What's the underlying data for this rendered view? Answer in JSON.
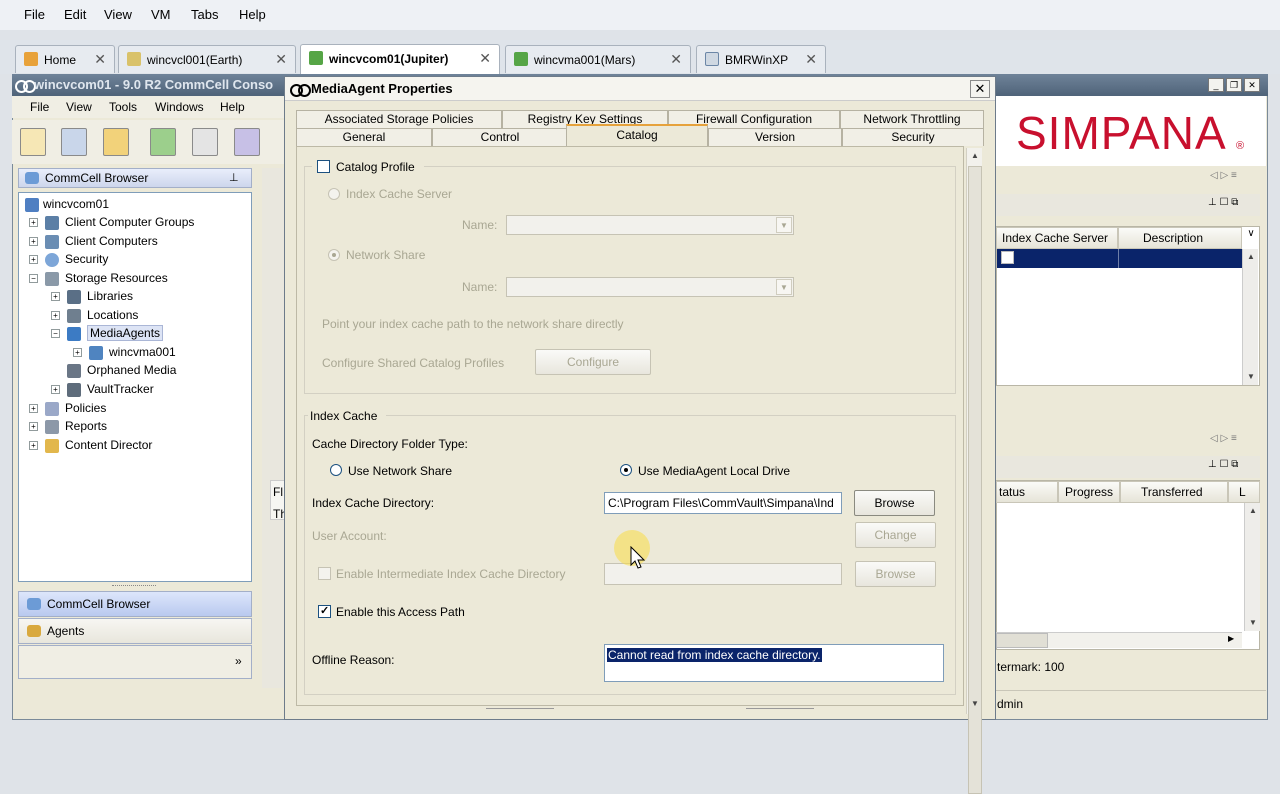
{
  "vm_menu": [
    "File",
    "Edit",
    "View",
    "VM",
    "Tabs",
    "Help"
  ],
  "vm_tabs": [
    {
      "label": "Home"
    },
    {
      "label": "wincvcl001(Earth)"
    },
    {
      "label": "wincvcom01(Jupiter)"
    },
    {
      "label": "wincvma001(Mars)"
    },
    {
      "label": "BMRWinXP"
    }
  ],
  "console": {
    "title": "wincvcom01 - 9.0 R2 CommCell Conso",
    "menu": [
      "File",
      "View",
      "Tools",
      "Windows",
      "Help"
    ],
    "brand": "SIMPANA",
    "brand_mark": "®",
    "browser_title": "CommCell Browser",
    "tree": {
      "root": "wincvcom01",
      "items": [
        "Client Computer Groups",
        "Client Computers",
        "Security",
        "Storage Resources",
        "Libraries",
        "Locations",
        "MediaAgents",
        "wincvma001",
        "Orphaned Media",
        "VaultTracker",
        "Policies",
        "Reports",
        "Content Director"
      ]
    },
    "nav_buttons": [
      "CommCell Browser",
      "Agents"
    ],
    "grid1_headers": [
      "Index Cache Server",
      "Description"
    ],
    "grid2_headers": [
      "tatus",
      "Progress",
      "Transferred",
      "L"
    ],
    "partial_left": [
      "Fl",
      "Th"
    ],
    "watermark": "termark: 100",
    "status_user": "dmin"
  },
  "dialog": {
    "title": "MediaAgent Properties",
    "close": "✕",
    "tabs_back": [
      "Associated Storage Policies",
      "Registry Key Settings",
      "Firewall Configuration",
      "Network Throttling"
    ],
    "tabs_front": [
      "General",
      "Control",
      "Catalog",
      "Version",
      "Security"
    ],
    "catalog": {
      "catalog_profile": "Catalog Profile",
      "index_cache_server": "Index Cache Server",
      "network_share": "Network Share",
      "name_label_1": "Name:",
      "name_label_2": "Name:",
      "point_text": "Point your index cache path to the network share directly",
      "configure_text": "Configure Shared Catalog Profiles",
      "configure_button": "Configure"
    },
    "index_cache": {
      "legend": "Index Cache",
      "folder_type": "Cache Directory Folder Type:",
      "use_network_share": "Use Network Share",
      "use_local_drive": "Use MediaAgent Local Drive",
      "dir_label": "Index Cache Directory:",
      "dir_value": "C:\\Program Files\\CommVault\\Simpana\\Ind",
      "browse_1": "Browse",
      "user_account": "User Account:",
      "change": "Change",
      "enable_intermediate": "Enable Intermediate Index Cache Directory",
      "browse_2": "Browse",
      "enable_access": "Enable this Access Path",
      "offline_label": "Offline Reason:",
      "offline_value": "Cannot read from index cache directory."
    }
  }
}
